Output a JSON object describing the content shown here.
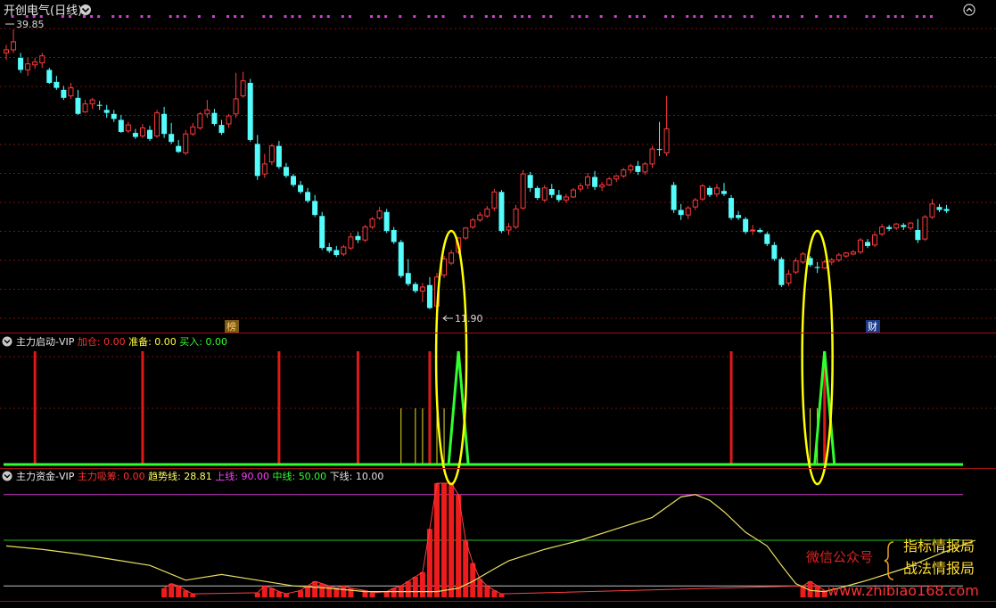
{
  "header": {
    "stock_title": "开创电气(日线)",
    "price_high_label": "39.85",
    "price_low_label": "11.90",
    "badge_left": "榜",
    "badge_right": "财"
  },
  "panel2": {
    "name": "主力启动-VIP",
    "items": [
      {
        "label": "加仓:",
        "value": "0.00",
        "color": "#ff3030"
      },
      {
        "label": "准备:",
        "value": "0.00",
        "color": "#ffff40"
      },
      {
        "label": "买入:",
        "value": "0.00",
        "color": "#30ff30"
      }
    ]
  },
  "panel3": {
    "name": "主力资金-VIP",
    "items": [
      {
        "label": "主力吸筹:",
        "value": "0.00",
        "color": "#ff3030"
      },
      {
        "label": "趋势线:",
        "value": "28.81",
        "color": "#ffff60"
      },
      {
        "label": "上线:",
        "value": "90.00",
        "color": "#ff40ff"
      },
      {
        "label": "中线:",
        "value": "50.00",
        "color": "#30ff30"
      },
      {
        "label": "下线:",
        "value": "10.00",
        "color": "#e0e0e0"
      }
    ]
  },
  "watermark": {
    "wechat_label": "微信公众号",
    "name1": "指标情报局",
    "name2": "战法情报局",
    "site": "www.zhibiao168.com"
  },
  "colors": {
    "up": "#ff3a3a",
    "down": "#54fcfc",
    "signal_red": "#e01818",
    "signal_yellow": "#e8e020",
    "signal_green": "#30ff30",
    "trend_line": "#e8e060",
    "upper_line": "#d040d0",
    "mid_line": "#20c020",
    "lower_line": "#c0c0c0",
    "grid": "#7a1010",
    "highlight": "#ffff00"
  },
  "chart_data": [
    {
      "type": "candlestick",
      "title": "开创电气(日线)",
      "ylim": [
        10,
        41
      ],
      "candles": [
        [
          37.5,
          38.3,
          36.8,
          37.8
        ],
        [
          37.8,
          39.85,
          37.5,
          38.6
        ],
        [
          37.0,
          37.5,
          35.5,
          35.8
        ],
        [
          35.8,
          37.0,
          35.2,
          36.4
        ],
        [
          36.3,
          37.0,
          35.9,
          36.6
        ],
        [
          36.5,
          37.5,
          36.0,
          37.2
        ],
        [
          35.8,
          36.0,
          34.4,
          34.5
        ],
        [
          34.6,
          35.2,
          33.8,
          34.0
        ],
        [
          33.8,
          34.2,
          32.8,
          33.0
        ],
        [
          33.2,
          34.5,
          32.9,
          34.0
        ],
        [
          33.0,
          33.8,
          31.3,
          31.4
        ],
        [
          31.6,
          32.8,
          31.5,
          32.4
        ],
        [
          32.4,
          33.0,
          31.9,
          32.8
        ],
        [
          32.3,
          32.7,
          31.8,
          32.2
        ],
        [
          31.8,
          32.3,
          31.0,
          31.5
        ],
        [
          31.4,
          31.8,
          30.6,
          30.9
        ],
        [
          30.8,
          31.3,
          29.5,
          29.6
        ],
        [
          29.7,
          30.6,
          29.5,
          30.3
        ],
        [
          29.5,
          29.9,
          28.9,
          29.1
        ],
        [
          29.2,
          30.4,
          29.0,
          30.0
        ],
        [
          29.8,
          30.2,
          28.7,
          28.9
        ],
        [
          29.2,
          31.8,
          29.0,
          31.5
        ],
        [
          31.4,
          32.1,
          29.0,
          29.4
        ],
        [
          29.4,
          30.5,
          28.4,
          28.6
        ],
        [
          28.2,
          28.8,
          27.5,
          27.6
        ],
        [
          27.5,
          29.8,
          27.3,
          29.4
        ],
        [
          29.4,
          30.5,
          29.2,
          30.1
        ],
        [
          30.0,
          31.6,
          29.8,
          31.4
        ],
        [
          31.4,
          32.8,
          31.0,
          31.8
        ],
        [
          31.5,
          31.9,
          30.2,
          30.4
        ],
        [
          30.3,
          30.8,
          29.3,
          29.5
        ],
        [
          30.4,
          31.4,
          30.0,
          31.2
        ],
        [
          31.4,
          35.5,
          31.0,
          32.9
        ],
        [
          33.2,
          35.6,
          33.0,
          34.7
        ],
        [
          34.5,
          34.9,
          28.6,
          28.8
        ],
        [
          28.4,
          29.3,
          24.8,
          25.2
        ],
        [
          25.4,
          27.4,
          25.0,
          26.4
        ],
        [
          26.6,
          28.4,
          26.3,
          28.2
        ],
        [
          28.2,
          28.7,
          25.9,
          26.1
        ],
        [
          26.1,
          26.5,
          25.0,
          25.2
        ],
        [
          25.2,
          25.4,
          24.1,
          24.3
        ],
        [
          24.3,
          24.7,
          23.4,
          23.6
        ],
        [
          23.6,
          24.0,
          22.5,
          22.7
        ],
        [
          22.7,
          23.3,
          21.1,
          21.3
        ],
        [
          21.2,
          21.6,
          17.8,
          18.0
        ],
        [
          18.1,
          18.5,
          17.5,
          17.7
        ],
        [
          17.8,
          18.2,
          17.1,
          17.3
        ],
        [
          17.4,
          18.3,
          17.2,
          18.1
        ],
        [
          18.0,
          19.5,
          17.8,
          19.1
        ],
        [
          19.2,
          19.6,
          18.5,
          18.8
        ],
        [
          18.8,
          20.3,
          18.6,
          20.1
        ],
        [
          20.1,
          21.1,
          19.9,
          20.9
        ],
        [
          21.0,
          22.1,
          20.8,
          21.7
        ],
        [
          21.6,
          21.9,
          19.5,
          19.7
        ],
        [
          19.8,
          20.1,
          18.4,
          18.6
        ],
        [
          18.6,
          18.8,
          15.0,
          15.2
        ],
        [
          15.5,
          16.9,
          14.2,
          14.4
        ],
        [
          14.4,
          14.6,
          13.5,
          13.7
        ],
        [
          13.7,
          14.5,
          12.6,
          14.1
        ],
        [
          14.3,
          15.1,
          11.9,
          12.0
        ],
        [
          12.2,
          15.5,
          12.0,
          15.1
        ],
        [
          15.3,
          17.2,
          15.0,
          16.9
        ],
        [
          16.5,
          17.8,
          16.3,
          17.5
        ],
        [
          17.6,
          19.1,
          17.4,
          19.0
        ],
        [
          19.0,
          20.1,
          18.8,
          20.0
        ],
        [
          20.1,
          21.0,
          19.9,
          20.8
        ],
        [
          20.8,
          21.6,
          20.6,
          21.3
        ],
        [
          21.2,
          22.2,
          21.0,
          21.9
        ],
        [
          22.0,
          23.9,
          21.7,
          23.6
        ],
        [
          23.6,
          23.8,
          19.5,
          19.7
        ],
        [
          19.8,
          20.5,
          19.3,
          20.1
        ],
        [
          20.1,
          22.3,
          19.9,
          21.9
        ],
        [
          22.0,
          25.8,
          21.8,
          25.4
        ],
        [
          25.3,
          25.6,
          23.6,
          24.0
        ],
        [
          24.0,
          24.2,
          22.8,
          23.0
        ],
        [
          22.8,
          24.3,
          22.6,
          24.0
        ],
        [
          23.9,
          24.4,
          23.0,
          23.3
        ],
        [
          23.3,
          23.8,
          22.6,
          22.8
        ],
        [
          22.8,
          23.4,
          22.5,
          23.1
        ],
        [
          23.1,
          24.0,
          23.0,
          23.8
        ],
        [
          23.9,
          24.5,
          23.6,
          24.2
        ],
        [
          24.3,
          25.5,
          23.9,
          25.1
        ],
        [
          25.1,
          25.7,
          23.8,
          24.1
        ],
        [
          24.1,
          24.6,
          23.7,
          24.3
        ],
        [
          24.3,
          25.1,
          24.2,
          24.9
        ],
        [
          24.9,
          25.3,
          24.6,
          25.2
        ],
        [
          25.2,
          26.0,
          25.0,
          25.8
        ],
        [
          25.8,
          26.4,
          25.5,
          26.2
        ],
        [
          26.2,
          26.7,
          25.3,
          25.6
        ],
        [
          25.6,
          26.6,
          25.3,
          26.4
        ],
        [
          26.4,
          28.2,
          26.0,
          27.9
        ],
        [
          27.9,
          30.6,
          27.2,
          27.8
        ],
        [
          27.5,
          33.2,
          27.2,
          29.9
        ],
        [
          24.3,
          24.6,
          21.5,
          21.8
        ],
        [
          21.8,
          22.4,
          20.8,
          21.3
        ],
        [
          21.3,
          22.2,
          20.9,
          22.0
        ],
        [
          22.1,
          23.0,
          21.8,
          22.8
        ],
        [
          22.9,
          24.4,
          22.7,
          24.2
        ],
        [
          24.0,
          24.2,
          23.1,
          23.3
        ],
        [
          23.4,
          24.4,
          23.1,
          24.0
        ],
        [
          23.7,
          24.5,
          23.2,
          23.4
        ],
        [
          23.0,
          23.3,
          20.8,
          21.0
        ],
        [
          21.3,
          21.7,
          20.8,
          21.0
        ],
        [
          20.9,
          21.1,
          19.4,
          19.6
        ],
        [
          19.8,
          20.3,
          19.3,
          19.8
        ],
        [
          19.8,
          20.0,
          19.5,
          19.6
        ],
        [
          19.4,
          19.6,
          18.2,
          18.4
        ],
        [
          18.3,
          18.6,
          16.7,
          16.9
        ],
        [
          16.9,
          17.1,
          14.1,
          14.3
        ],
        [
          14.5,
          15.8,
          14.2,
          15.4
        ],
        [
          15.6,
          17.0,
          15.4,
          16.7
        ],
        [
          16.6,
          17.6,
          16.4,
          17.4
        ],
        [
          17.0,
          17.2,
          16.1,
          16.3
        ],
        [
          16.1,
          16.6,
          15.5,
          16.0
        ],
        [
          16.0,
          16.8,
          15.9,
          16.6
        ],
        [
          16.6,
          17.0,
          16.3,
          16.8
        ],
        [
          16.8,
          17.5,
          16.6,
          17.3
        ],
        [
          17.2,
          17.6,
          17.0,
          17.5
        ],
        [
          17.4,
          17.8,
          17.3,
          17.6
        ],
        [
          17.6,
          19.0,
          17.4,
          18.8
        ],
        [
          18.6,
          18.9,
          18.0,
          18.2
        ],
        [
          18.3,
          19.6,
          18.1,
          19.3
        ],
        [
          19.4,
          20.4,
          19.2,
          20.1
        ],
        [
          20.1,
          20.3,
          19.7,
          19.9
        ],
        [
          20.0,
          20.5,
          19.8,
          20.4
        ],
        [
          20.3,
          20.5,
          19.8,
          20.1
        ],
        [
          20.0,
          20.6,
          19.8,
          20.5
        ],
        [
          19.8,
          20.9,
          18.5,
          18.8
        ],
        [
          18.9,
          21.3,
          18.7,
          21.1
        ],
        [
          21.1,
          22.9,
          20.9,
          22.4
        ],
        [
          22.1,
          22.4,
          21.6,
          21.8
        ],
        [
          21.9,
          22.3,
          21.5,
          21.7
        ]
      ]
    },
    {
      "type": "bar",
      "title": "主力启动-VIP",
      "series": [
        {
          "name": "加仓",
          "values": [
            [
              4,
              100
            ],
            [
              19,
              100
            ],
            [
              38,
              100
            ],
            [
              49,
              100
            ],
            [
              59,
              100
            ],
            [
              101,
              100
            ],
            [
              114,
              100
            ]
          ]
        },
        {
          "name": "准备",
          "values": [
            [
              55,
              50
            ],
            [
              57,
              50
            ],
            [
              58,
              50
            ],
            [
              59,
              50
            ],
            [
              60,
              50
            ],
            [
              61,
              50
            ],
            [
              112,
              50
            ],
            [
              113,
              50
            ]
          ]
        },
        {
          "name": "买入",
          "values": [
            [
              63,
              100
            ],
            [
              114,
              100
            ]
          ]
        }
      ]
    },
    {
      "type": "bar",
      "title": "主力资金-VIP",
      "ylim": [
        0,
        100
      ],
      "series": [
        {
          "name": "主力吸筹",
          "values": [
            [
              22,
              8
            ],
            [
              23,
              12
            ],
            [
              24,
              10
            ],
            [
              25,
              6
            ],
            [
              26,
              3
            ],
            [
              35,
              4
            ],
            [
              36,
              10
            ],
            [
              37,
              8
            ],
            [
              38,
              5
            ],
            [
              39,
              3
            ],
            [
              41,
              6
            ],
            [
              42,
              10
            ],
            [
              43,
              14
            ],
            [
              44,
              12
            ],
            [
              45,
              10
            ],
            [
              46,
              8
            ],
            [
              47,
              10
            ],
            [
              48,
              8
            ],
            [
              50,
              6
            ],
            [
              51,
              4
            ],
            [
              53,
              5
            ],
            [
              54,
              8
            ],
            [
              55,
              10
            ],
            [
              56,
              14
            ],
            [
              57,
              18
            ],
            [
              58,
              22
            ],
            [
              59,
              60
            ],
            [
              60,
              100
            ],
            [
              61,
              100
            ],
            [
              62,
              100
            ],
            [
              63,
              90
            ],
            [
              64,
              50
            ],
            [
              65,
              30
            ],
            [
              66,
              16
            ],
            [
              67,
              10
            ],
            [
              68,
              6
            ],
            [
              69,
              3
            ],
            [
              111,
              10
            ],
            [
              112,
              14
            ],
            [
              113,
              10
            ],
            [
              114,
              6
            ]
          ]
        },
        {
          "name": "趋势线",
          "values": [
            [
              0,
              45
            ],
            [
              5,
              42
            ],
            [
              10,
              38
            ],
            [
              15,
              33
            ],
            [
              20,
              28
            ],
            [
              25,
              15
            ],
            [
              30,
              20
            ],
            [
              35,
              15
            ],
            [
              40,
              10
            ],
            [
              45,
              8
            ],
            [
              50,
              5
            ],
            [
              55,
              5
            ],
            [
              60,
              5
            ],
            [
              63,
              8
            ],
            [
              65,
              14
            ],
            [
              68,
              25
            ],
            [
              70,
              32
            ],
            [
              75,
              42
            ],
            [
              80,
              50
            ],
            [
              85,
              60
            ],
            [
              90,
              70
            ],
            [
              94,
              88
            ],
            [
              96,
              90
            ],
            [
              98,
              85
            ],
            [
              100,
              75
            ],
            [
              103,
              57
            ],
            [
              106,
              45
            ],
            [
              108,
              28
            ],
            [
              110,
              12
            ],
            [
              112,
              6
            ],
            [
              114,
              5
            ],
            [
              116,
              8
            ],
            [
              120,
              15
            ],
            [
              125,
              25
            ],
            [
              130,
              38
            ],
            [
              135,
              50
            ]
          ]
        },
        {
          "name": "上线",
          "values": [
            [
              0,
              90
            ],
            [
              135,
              90
            ]
          ]
        },
        {
          "name": "中线",
          "values": [
            [
              0,
              50
            ],
            [
              135,
              50
            ]
          ]
        },
        {
          "name": "下线",
          "values": [
            [
              0,
              10
            ],
            [
              135,
              10
            ]
          ]
        }
      ]
    }
  ]
}
